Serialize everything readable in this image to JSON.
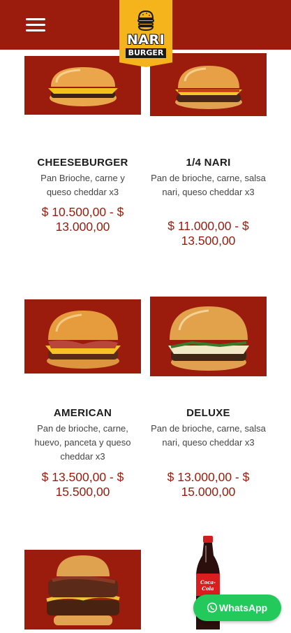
{
  "header": {
    "background": "#9b1b0c",
    "menu_icon": "hamburger-menu-icon",
    "logo": {
      "line1": "NARI",
      "line2": "BURGER",
      "background": "#f5b31c"
    }
  },
  "products": [
    {
      "name": "CHEESEBURGER",
      "description": "Pan Brioche, carne y queso cheddar x3",
      "price": "$ 10.500,00 - $ 13.000,00",
      "image": "cheeseburger-photo"
    },
    {
      "name": "1/4 NARI",
      "description": "Pan de brioche, carne, salsa nari, queso cheddar x3",
      "price": "$ 11.000,00 - $ 13.500,00",
      "image": "nari-burger-photo"
    },
    {
      "name": "AMERICAN",
      "description": "Pan de brioche, carne, huevo, panceta y queso cheddar x3",
      "price": "$ 13.500,00 - $ 15.500,00",
      "image": "american-burger-photo"
    },
    {
      "name": "DELUXE",
      "description": "Pan de brioche, carne, salsa nari, queso cheddar x3",
      "price": "$ 13.000,00 - $ 15.000,00",
      "image": "deluxe-burger-photo"
    },
    {
      "image": "bacon-burger-photo"
    },
    {
      "image": "coca-cola-bottle-photo",
      "bottle_label": "Coca-Cola"
    }
  ],
  "whatsapp": {
    "label": "WhatsApp",
    "icon": "whatsapp-icon",
    "color": "#23c95a"
  },
  "colors": {
    "accent": "#9b1b0c",
    "price": "#9b1b0c",
    "logo": "#f5b31c"
  }
}
